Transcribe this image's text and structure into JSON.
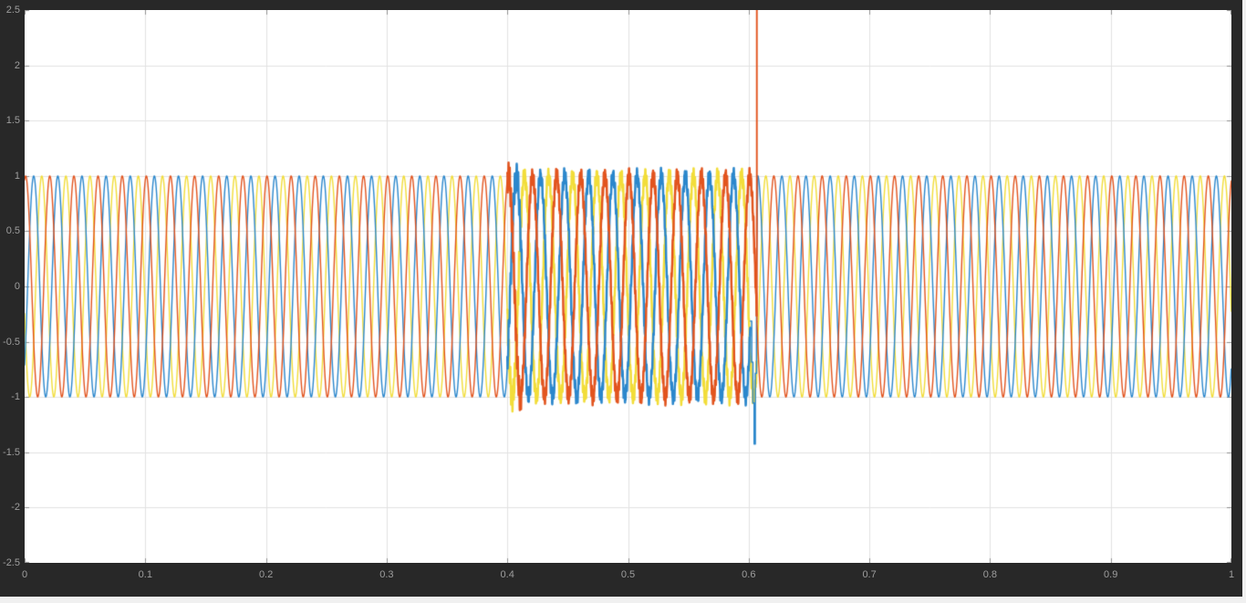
{
  "window": {
    "background": "#282828",
    "edge_color": "#f0f0f0"
  },
  "chart_data": {
    "type": "line",
    "title": "",
    "xlabel": "",
    "ylabel": "",
    "description": "Three-phase 50 Hz sinusoidal waveforms of amplitude 1 on a scope; high-frequency ripple disturbance between t=0.4 and t=0.606; clearing transients near t=0.606 (orange spike above +2.5 clipped at plot top, blue dip to -1.5).",
    "grid": true,
    "legend": null,
    "plot_bg": "#ffffff",
    "grid_color": "#e2e2e2",
    "tick_color": "#8f8f8f",
    "label_color": "#9e9e9e",
    "x_range": [
      0,
      1
    ],
    "y_range": [
      -2.5,
      2.5
    ],
    "x_tick_values": [
      0,
      0.1,
      0.2,
      0.3,
      0.4,
      0.5,
      0.6,
      0.7,
      0.8,
      0.9,
      1
    ],
    "x_tick_labels": [
      "0",
      "0.1",
      "0.2",
      "0.3",
      "0.4",
      "0.5",
      "0.6",
      "0.7",
      "0.8",
      "0.9",
      "1"
    ],
    "y_tick_values": [
      -2.5,
      -2,
      -1.5,
      -1,
      -0.5,
      0,
      0.5,
      1,
      1.5,
      2,
      2.5
    ],
    "y_tick_labels": [
      "-2.5",
      "-2",
      "-1.5",
      "-1",
      "-0.5",
      "0",
      "0.5",
      "1",
      "1.5",
      "2",
      "2.5"
    ],
    "series": [
      {
        "name": "series-yellow",
        "color": "#f2dd39",
        "waveform": "sine",
        "frequency_hz": 50,
        "amplitude": 1,
        "phase_rad": 3.39,
        "fault": {
          "start": 0.4,
          "end": 0.6066,
          "ripple_amplitude": 0.05,
          "ripple_frequency_hz": 823
        },
        "transient": null
      },
      {
        "name": "series-blue",
        "color": "#2b87cc",
        "waveform": "sine",
        "frequency_hz": 50,
        "amplitude": 1,
        "phase_rad": -0.79,
        "fault": {
          "start": 0.4,
          "end": 0.6015,
          "ripple_amplitude": 0.05,
          "ripple_frequency_hz": 761
        },
        "transient": {
          "type": "dip",
          "start": 0.6015,
          "bottom_time": 0.6047,
          "end": 0.6075,
          "value": -1.5
        }
      },
      {
        "name": "series-orange",
        "color": "#e2541e",
        "waveform": "sine",
        "frequency_hz": 50,
        "amplitude": 1,
        "phase_rad": 1.3,
        "fault": {
          "start": 0.4,
          "end": 0.6066,
          "ripple_amplitude": 0.05,
          "ripple_frequency_hz": 911
        },
        "transient": {
          "type": "spike",
          "time": 0.6066,
          "value": 2.6
        }
      }
    ]
  }
}
